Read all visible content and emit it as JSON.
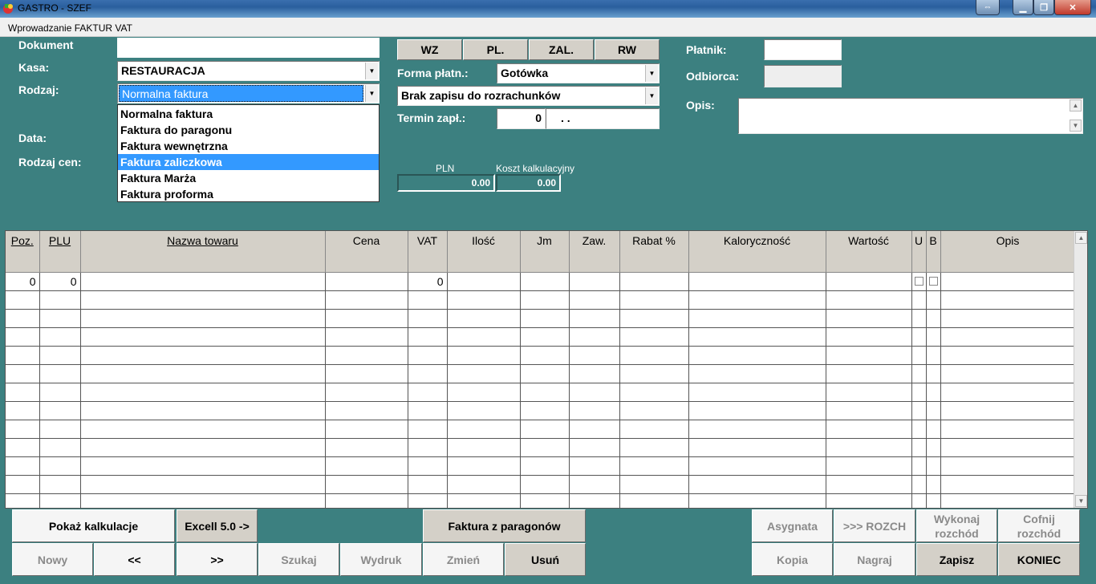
{
  "window": {
    "title": "GASTRO - SZEF",
    "subtitle": "Wprowadzanie FAKTUR VAT"
  },
  "form": {
    "dokument_label": "Dokument",
    "dokument_value": "",
    "kasa_label": "Kasa:",
    "kasa_value": "RESTAURACJA",
    "rodzaj_label": "Rodzaj:",
    "rodzaj_value": "Normalna faktura",
    "data_label": "Data:",
    "rodzaj_cen_label": "Rodzaj cen:",
    "rodzaj_options": [
      "Normalna faktura",
      "Faktura do paragonu",
      "Faktura wewnętrzna",
      "Faktura zaliczkowa",
      "Faktura Marża",
      "Faktura proforma"
    ],
    "rodzaj_highlighted": "Faktura zaliczkowa",
    "forma_label": "Forma płatn.:",
    "forma_value": "Gotówka",
    "rozrachunki_value": "Brak zapisu do rozrachunków",
    "termin_label": "Termin zapł.:",
    "termin_days": "0",
    "termin_date": ". .",
    "pln_label": "PLN",
    "koszt_label": "Koszt kalkulacyjny",
    "pln_value": "0.00",
    "koszt_value": "0.00",
    "platnik_label": "Płatnik:",
    "odbiorca_label": "Odbiorca:",
    "opis_label": "Opis:"
  },
  "doc_buttons": [
    "WZ",
    "PL.",
    "ZAL.",
    "RW"
  ],
  "grid": {
    "headers": [
      "Poz.",
      "PLU",
      "Nazwa towaru",
      "Cena",
      "VAT",
      "Ilość",
      "Jm",
      "Zaw.",
      "Rabat %",
      "Kaloryczność",
      "Wartość",
      "U",
      "B",
      "Opis"
    ],
    "first_row": {
      "poz": "0",
      "plu": "0",
      "vat": "0"
    }
  },
  "bottom": {
    "pokaz": "Pokaż kalkulacje",
    "excell": "Excell 5.0 ->",
    "faktura_z_par": "Faktura z paragonów",
    "asygnata": "Asygnata",
    "rozch": ">>> ROZCH",
    "wykonaj": "Wykonaj rozchód",
    "cofnij": "Cofnij rozchód",
    "nowy": "Nowy",
    "prev": "<<",
    "next": ">>",
    "szukaj": "Szukaj",
    "wydruk": "Wydruk",
    "zmien": "Zmień",
    "usun": "Usuń",
    "kopia": "Kopia",
    "nagraj": "Nagraj",
    "zapisz": "Zapisz",
    "koniec": "KONIEC"
  }
}
